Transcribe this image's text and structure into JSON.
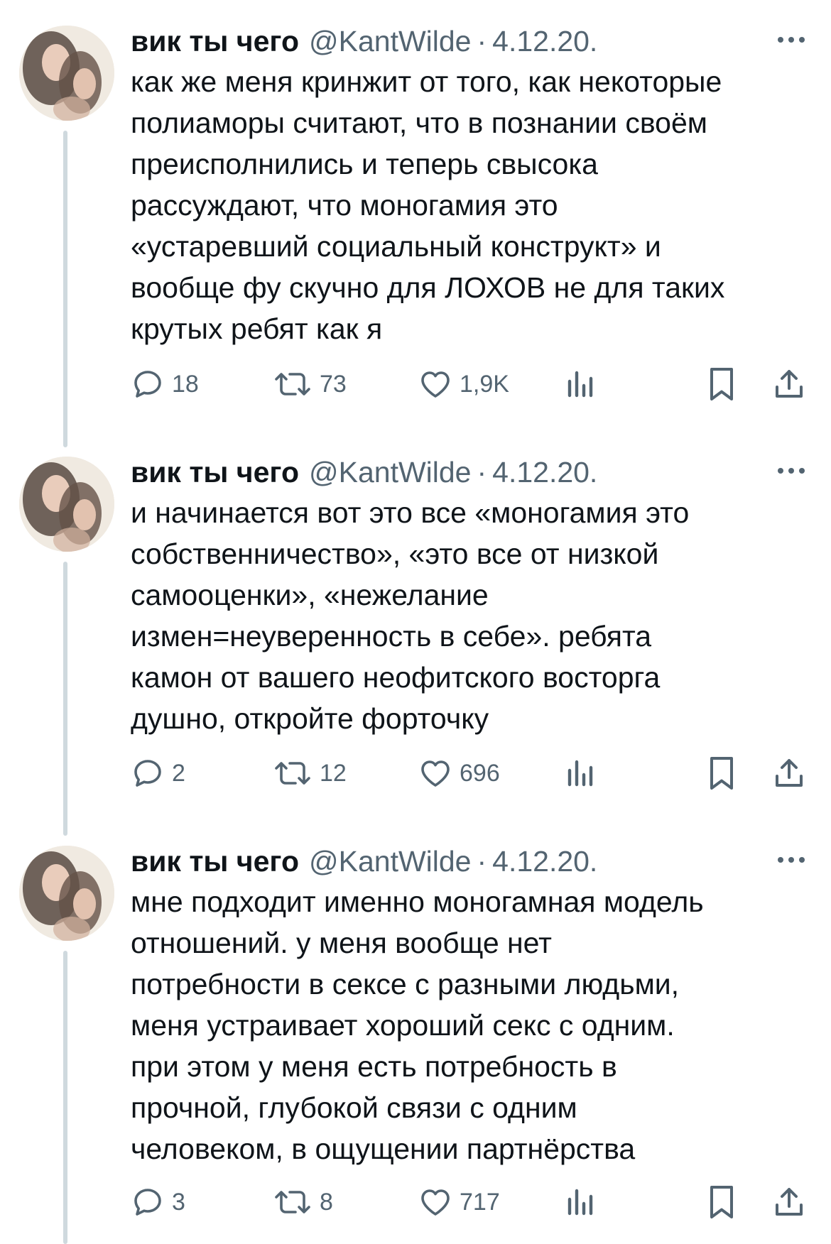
{
  "author": {
    "display_name": "вик ты чего",
    "handle": "@KantWilde",
    "separator": "·",
    "date": "4.12.20."
  },
  "icons": {
    "reply": "reply-icon",
    "retweet": "retweet-icon",
    "like": "heart-icon",
    "views": "views-icon",
    "bookmark": "bookmark-icon",
    "share": "share-icon",
    "more": "more-options-icon"
  },
  "colors": {
    "text": "#0f1419",
    "secondary": "#536471",
    "thread_line": "#cfd9de"
  },
  "tweets": [
    {
      "text": "как же меня кринжит от того, как некоторые\nполиаморы считают, что в познании своём\nпреисполнились и теперь свысока\nрассуждают, что моногамия это\n«устаревший социальный конструкт» и\nвообще фу скучно для ЛОХОВ не для таких\nкрутых ребят как я",
      "replies": "18",
      "retweets": "73",
      "likes": "1,9K"
    },
    {
      "text": "и начинается вот это все «моногамия это\nсобственничество», «это все от низкой\nсамооценки», «нежелание\nизмен=неуверенность в себе». ребята\nкамон от вашего неофитского восторга\nдушно, откройте форточку",
      "replies": "2",
      "retweets": "12",
      "likes": "696"
    },
    {
      "text": "мне подходит именно моногамная модель\nотношений. у меня вообще нет\nпотребности в сексе с разными людьми,\nменя устраивает хороший секс с одним.\nпри этом у меня есть потребность в\nпрочной, глубокой связи с одним\nчеловеком, в ощущении партнёрства",
      "replies": "3",
      "retweets": "8",
      "likes": "717"
    }
  ]
}
